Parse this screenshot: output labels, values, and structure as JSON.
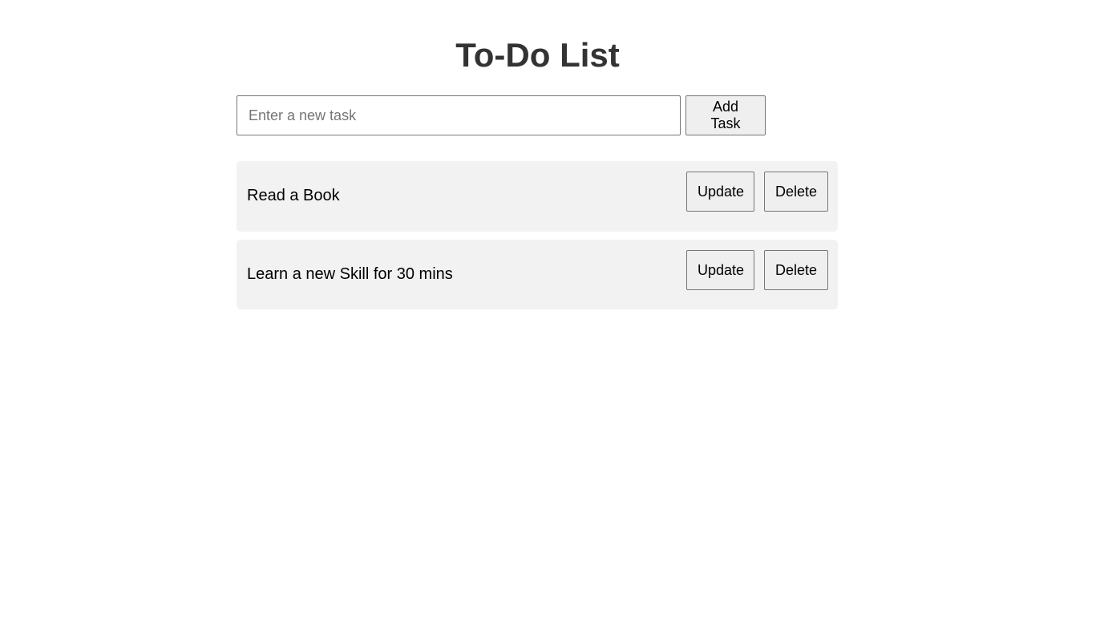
{
  "page": {
    "title": "To-Do List"
  },
  "new_task": {
    "placeholder": "Enter a new task",
    "value": "",
    "add_label": "Add Task"
  },
  "tasks": [
    {
      "text": "Read a Book",
      "update_label": "Update",
      "delete_label": "Delete"
    },
    {
      "text": "Learn a new Skill for 30 mins",
      "update_label": "Update",
      "delete_label": "Delete"
    }
  ],
  "colors": {
    "background": "#ffffff",
    "title_text": "#333333",
    "task_background": "#f2f2f2",
    "button_background": "#efefef",
    "border": "#767676"
  }
}
